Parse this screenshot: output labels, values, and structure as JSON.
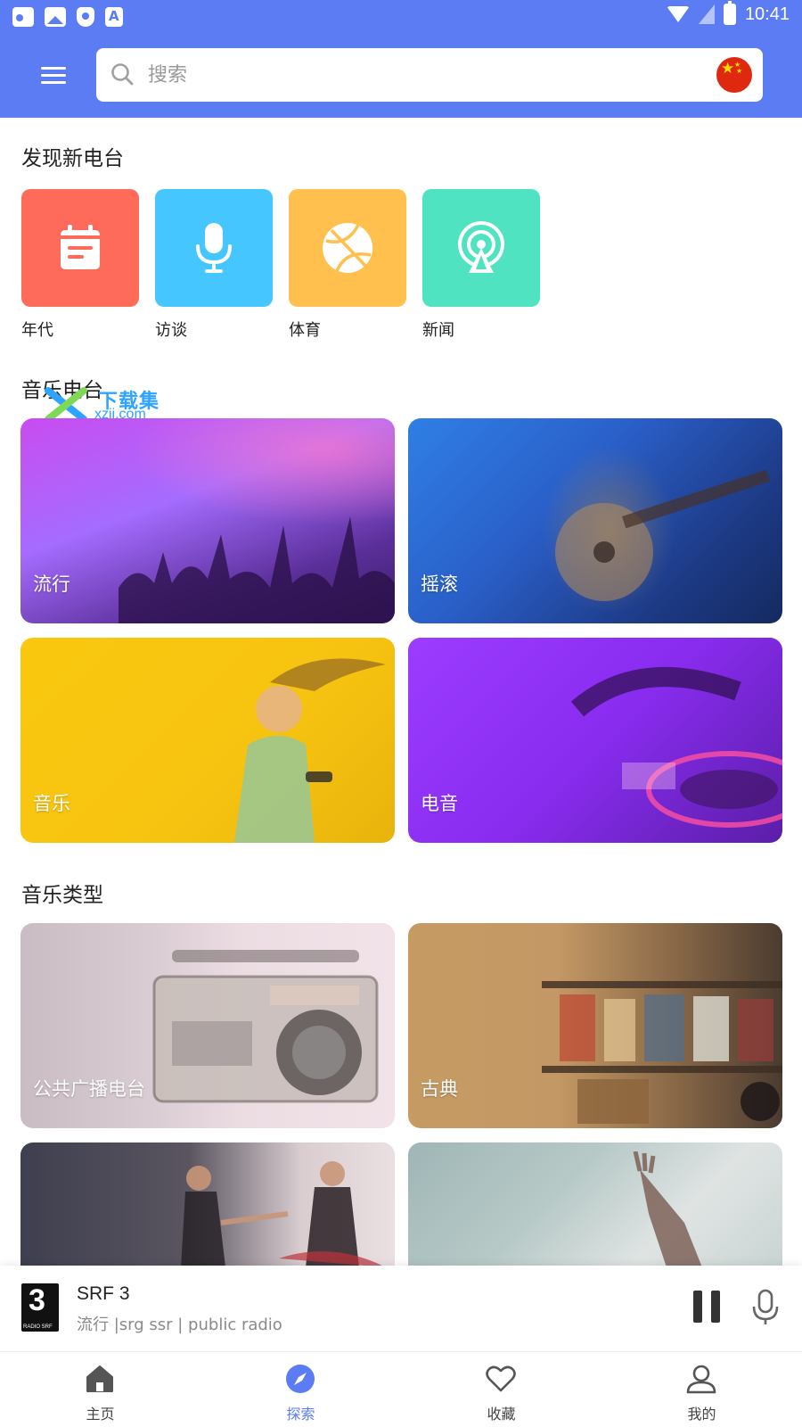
{
  "status_bar": {
    "time": "10:41"
  },
  "search": {
    "placeholder": "搜索"
  },
  "discover": {
    "title": "发现新电台",
    "categories": [
      {
        "label": "年代",
        "color": "#ff6b5a",
        "icon": "calendar-icon"
      },
      {
        "label": "访谈",
        "color": "#45c6ff",
        "icon": "microphone-icon"
      },
      {
        "label": "体育",
        "color": "#ffc04d",
        "icon": "basketball-icon"
      },
      {
        "label": "新闻",
        "color": "#4fe3c1",
        "icon": "broadcast-icon"
      }
    ]
  },
  "watermark": {
    "text": "下载集",
    "sub": "xzji.com"
  },
  "music_stations": {
    "title": "音乐电台",
    "cards": [
      {
        "label": "流行"
      },
      {
        "label": "摇滚"
      },
      {
        "label": "音乐"
      },
      {
        "label": "电音"
      }
    ]
  },
  "music_types": {
    "title": "音乐类型",
    "cards": [
      {
        "label": "公共广播电台"
      },
      {
        "label": "古典"
      }
    ]
  },
  "player": {
    "logo_text": "3",
    "logo_caption": "RADIO SRF",
    "station_name": "SRF 3",
    "station_info": "流行 |srg ssr | public radio"
  },
  "bottom_nav": {
    "items": [
      {
        "label": "主页",
        "icon": "home-icon"
      },
      {
        "label": "探索",
        "icon": "compass-icon"
      },
      {
        "label": "收藏",
        "icon": "heart-icon"
      },
      {
        "label": "我的",
        "icon": "user-icon"
      }
    ],
    "active_index": 1
  }
}
